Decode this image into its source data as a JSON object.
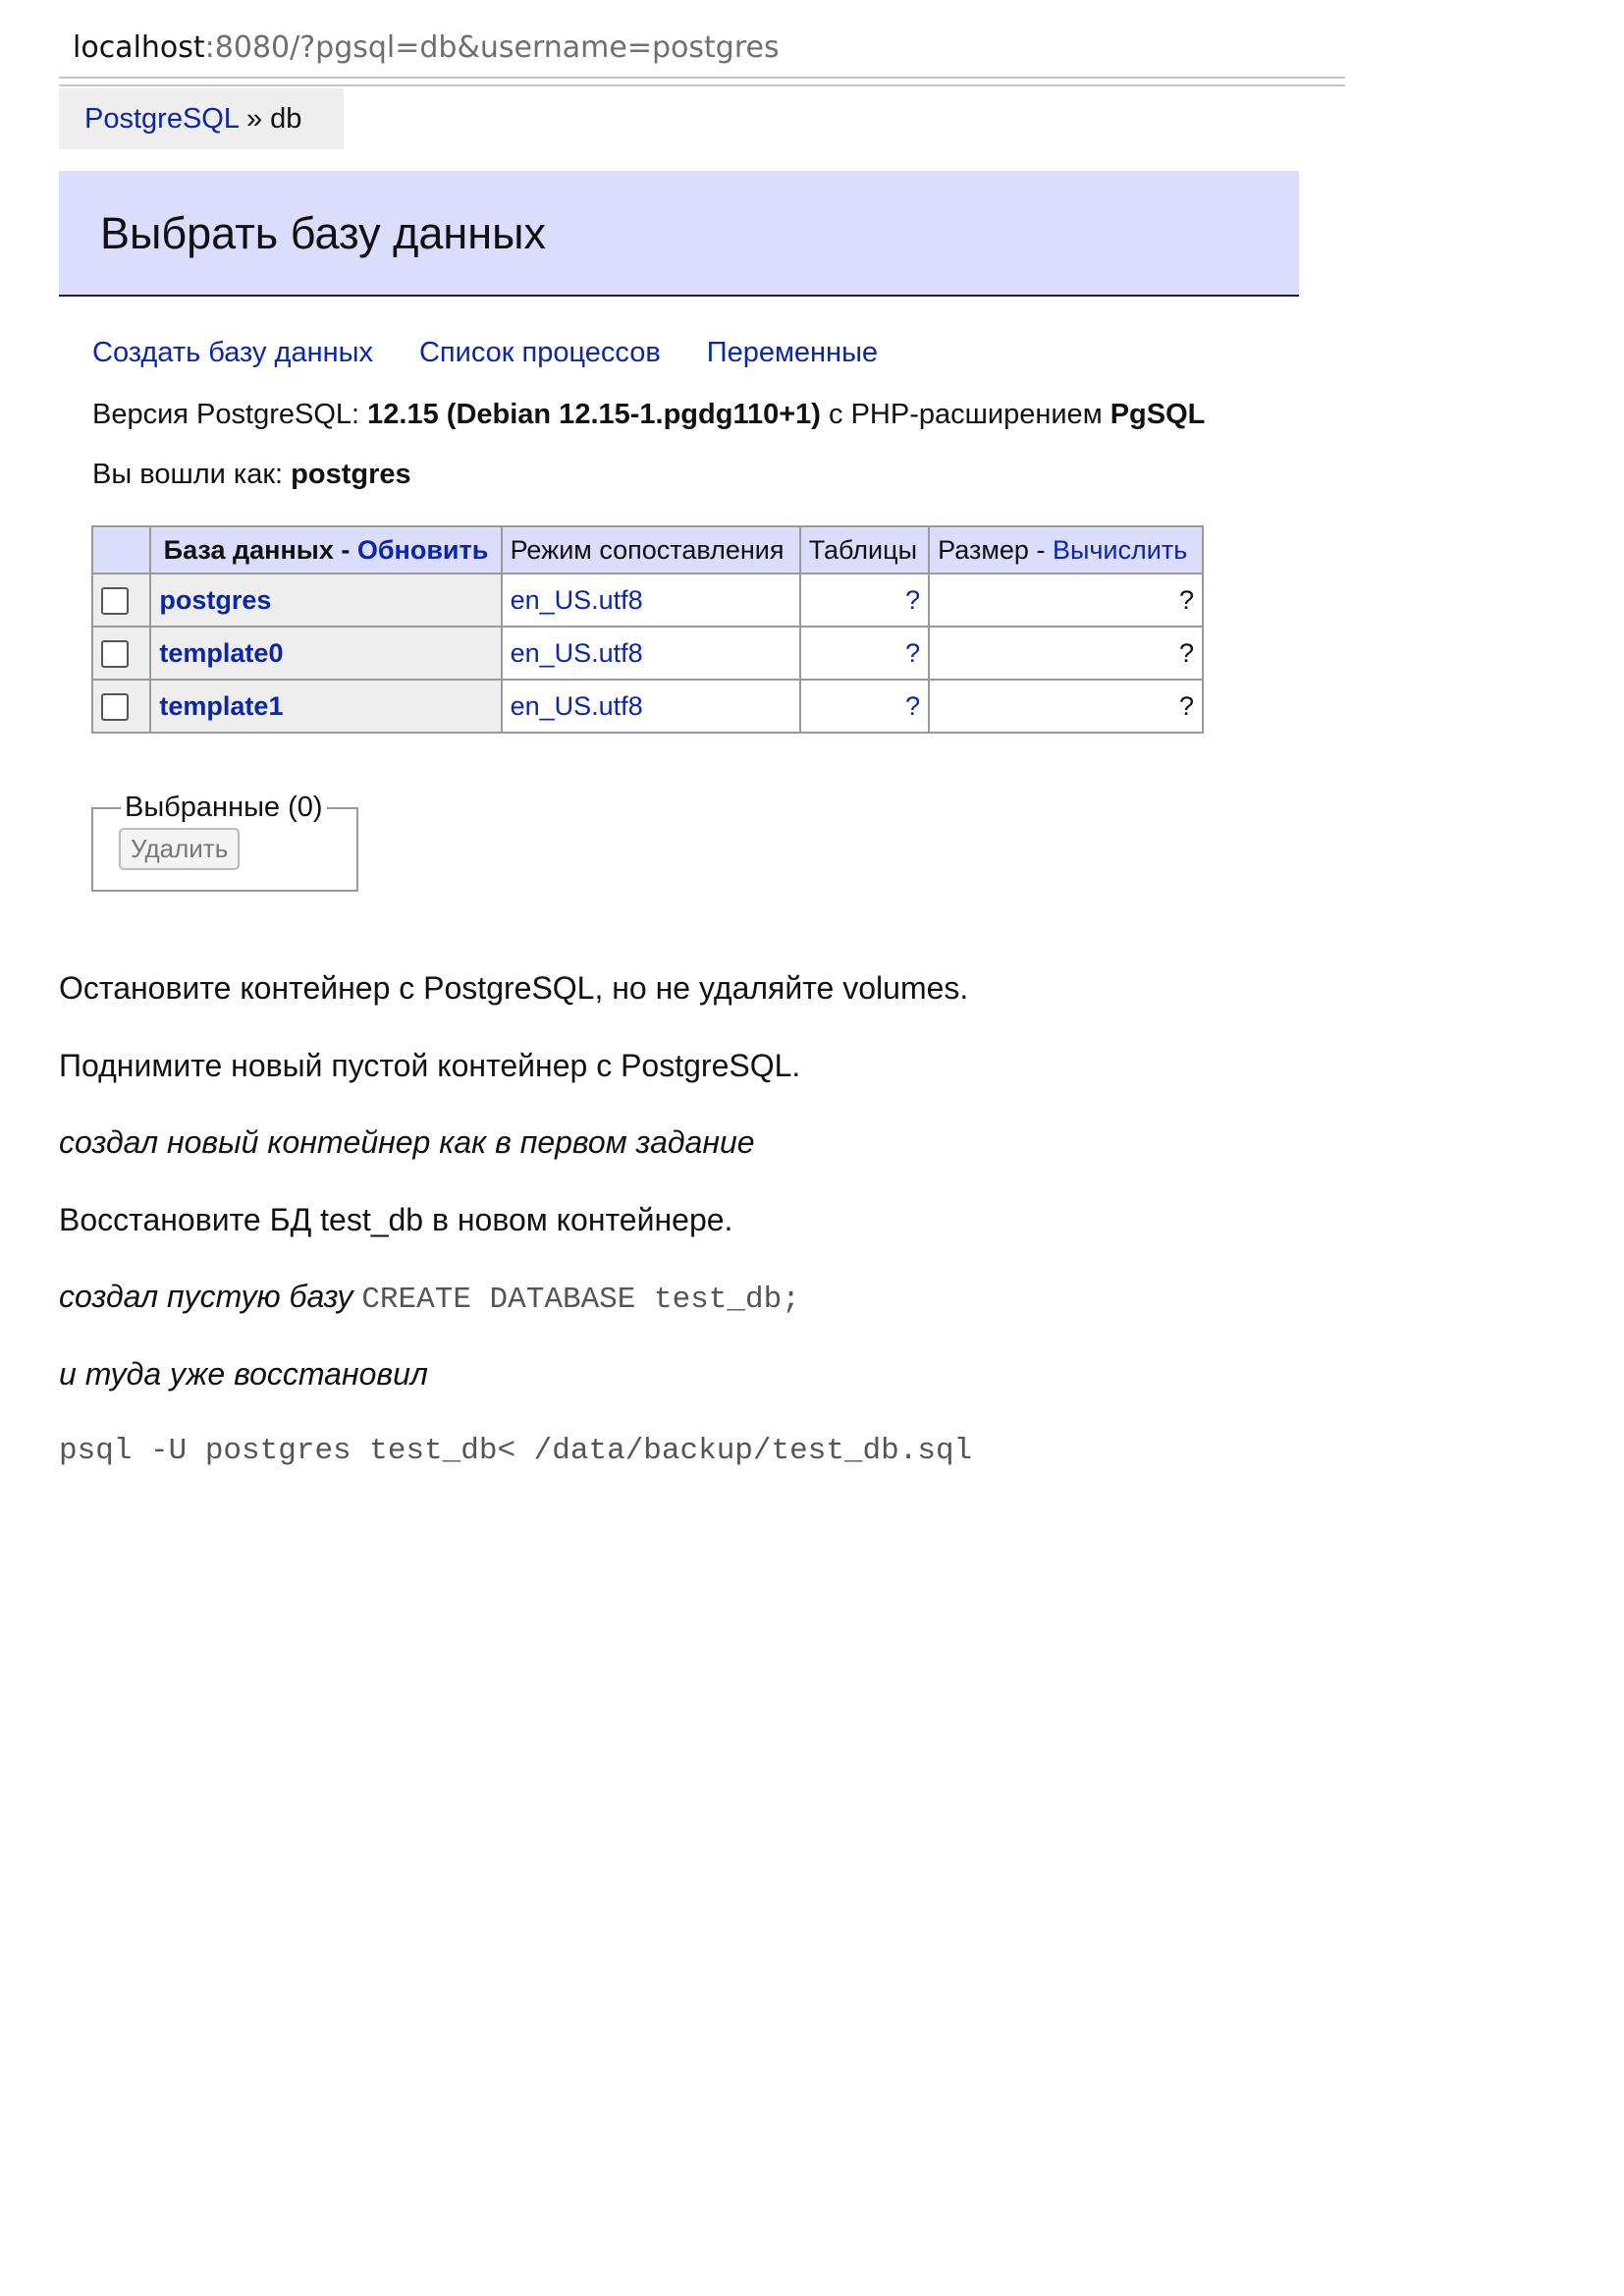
{
  "browser": {
    "url_host": "localhost",
    "url_rest": ":8080/?pgsql=db&username=postgres"
  },
  "breadcrumb": {
    "link": "PostgreSQL",
    "separator": " » ",
    "current": "db"
  },
  "page": {
    "title": "Выбрать базу данных"
  },
  "actions": {
    "create_db": "Создать базу данных",
    "process_list": "Список процессов",
    "variables": "Переменные"
  },
  "info": {
    "version_label": "Версия PostgreSQL: ",
    "version_value": "12.15 (Debian 12.15-1.pgdg110+1)",
    "ext_label": " с PHP-расширением ",
    "ext_value": "PgSQL",
    "user_label": "Вы вошли как: ",
    "user_value": "postgres"
  },
  "table": {
    "headers": {
      "database": "База данных",
      "dash1": " - ",
      "refresh": "Обновить",
      "collation": "Режим сопоставления",
      "tables": "Таблицы",
      "size": "Размер",
      "dash2": " - ",
      "compute": "Вычислить"
    },
    "rows": [
      {
        "name": "postgres",
        "collation": "en_US.utf8",
        "tables": "?",
        "size": "?"
      },
      {
        "name": "template0",
        "collation": "en_US.utf8",
        "tables": "?",
        "size": "?"
      },
      {
        "name": "template1",
        "collation": "en_US.utf8",
        "tables": "?",
        "size": "?"
      }
    ]
  },
  "selected": {
    "legend": "Выбранные (0)",
    "delete_label": "Удалить"
  },
  "doc": {
    "p1": "Остановите контейнер с PostgreSQL, но не удаляйте volumes.",
    "p2": "Поднимите новый пустой контейнер с PostgreSQL.",
    "p3": "создал новый контейнер как в первом задание",
    "p4": "Восстановите БД test_db в новом контейнере.",
    "p5_text": "создал пустую базу ",
    "p5_code": "CREATE DATABASE test_db;",
    "p6": "и туда уже восстановил",
    "p7_code": "psql -U postgres test_db< /data/backup/test_db.sql"
  },
  "colors": {
    "link": "#0b26a8",
    "header_bg": "#dcdcfc",
    "cell_bg": "#eeeeee"
  }
}
